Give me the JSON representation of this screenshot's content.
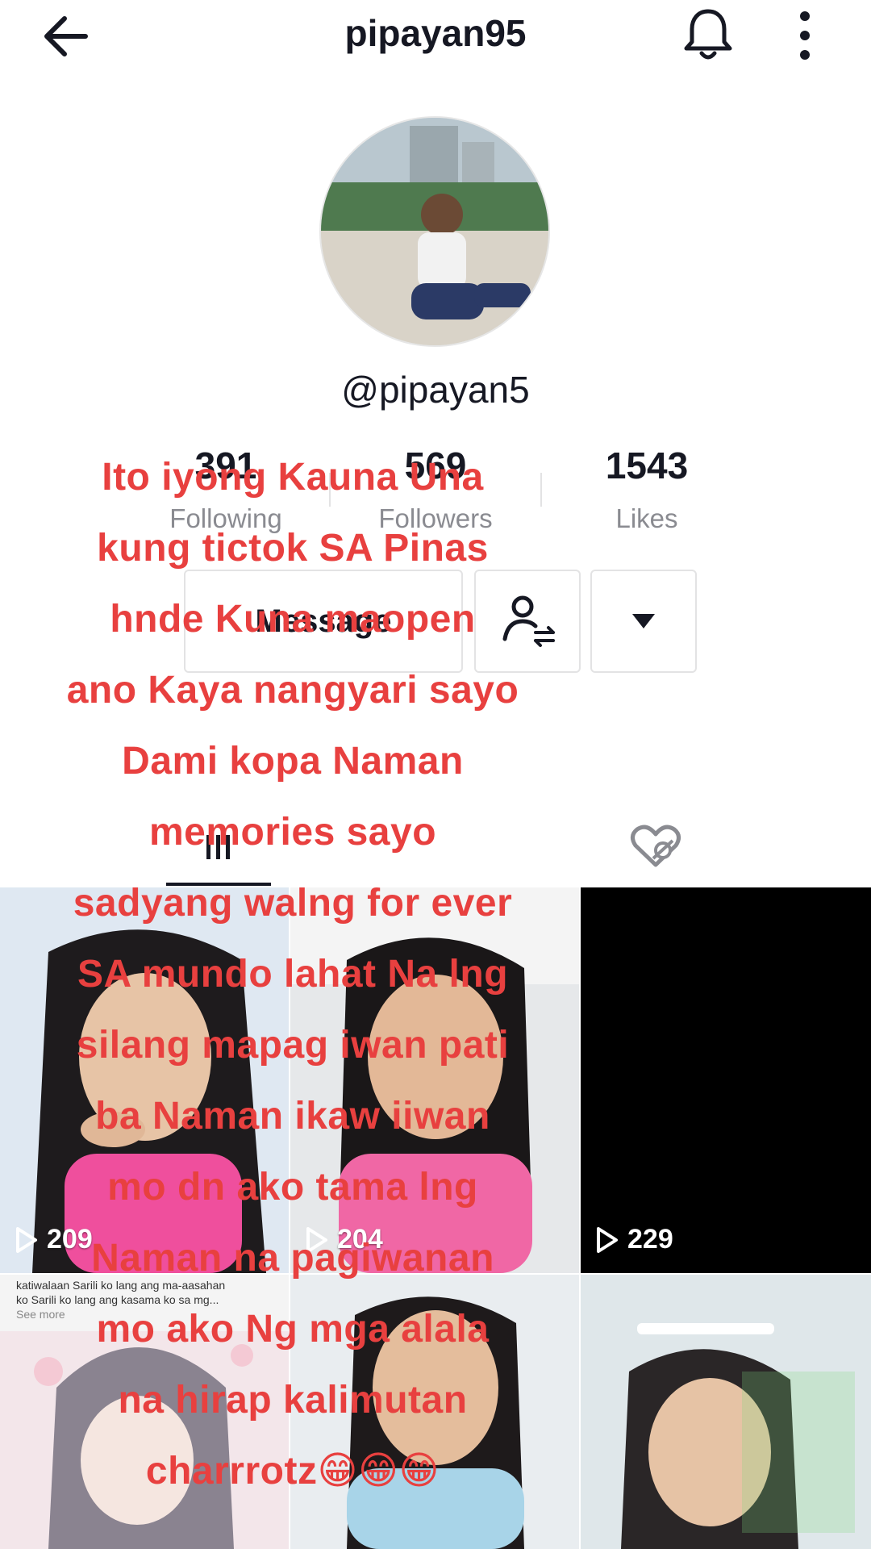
{
  "header": {
    "title": "pipayan95"
  },
  "profile": {
    "handle": "@pipayan5"
  },
  "stats": [
    {
      "value": "391",
      "label": "Following"
    },
    {
      "value": "569",
      "label": "Followers"
    },
    {
      "value": "1543",
      "label": "Likes"
    }
  ],
  "actions": {
    "message_label": "Message"
  },
  "videos": [
    {
      "views": "209"
    },
    {
      "views": "204"
    },
    {
      "views": "229"
    }
  ],
  "video4_caption": {
    "line1": "katiwalaan Sarili ko lang ang ma-aasahan",
    "line2": "ko Sarili ko lang ang kasama ko sa mg...",
    "see_more": "See more"
  },
  "overlay_text": [
    "Ito iyong Kauna Una",
    "kung tictok SA Pinas",
    "hnde Kuna maopen",
    "ano Kaya nangyari sayo",
    "Dami kopa Naman",
    "memories sayo",
    "sadyang walng for ever",
    "SA mundo lahat Na lng",
    "silang mapag iwan pati",
    "ba Naman ikaw iiwan",
    "mo dn ako tama lng",
    "Naman na pagiwanan",
    "mo ako Ng mga alala",
    "na hirap kalimutan",
    "charrrotz😁😁😁"
  ],
  "colors": {
    "overlay": "#e8403f",
    "text": "#161823",
    "muted": "#8a8b91"
  },
  "icons": [
    "back-arrow-icon",
    "bell-icon",
    "more-vertical-icon",
    "add-friend-icon",
    "dropdown-arrow-icon",
    "grid-icon",
    "liked-hidden-icon",
    "play-icon"
  ]
}
